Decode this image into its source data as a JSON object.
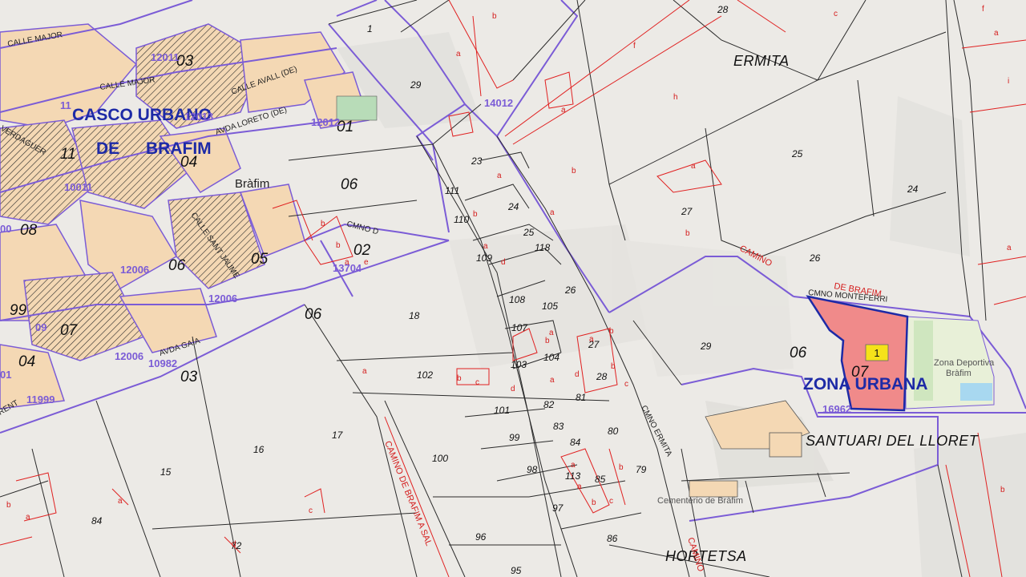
{
  "labels": {
    "casco": "CASCO URBANO",
    "de": "DE",
    "brafim_town": "BRAFIM",
    "ermita": "ERMITA",
    "zona_urbana": "ZONA URBANA",
    "santuari": "SANTUARI DEL LLORET",
    "hortetsa": "HORTETSA",
    "brafim_point": "Bràfim",
    "cementerio": "Cementerio de Bràfim",
    "zona_deportiva_1": "Zona Deportiva",
    "zona_deportiva_2": "Bràfim",
    "selected_parcel_badge": "1"
  },
  "streets": {
    "calle_major": "CALLE MAJOR",
    "carrer_avall": "CALLE AVALL (DE)",
    "avda_loreto": "AVDA LORETO (DE)",
    "calle_major2": "CALLE MAJOR",
    "verdaguer": "VERDAGUER",
    "sant_jaume": "CALLE SANT JAUME",
    "avda_gaia": "AVDA GAIA",
    "cmno_d": "CMNO D",
    "cami_ermita": "CMNO ERMITA",
    "cami_monteferri": "CMNO MONTEFERRI",
    "camino_brafim": "CAMINO",
    "de_brafim": "DE BRAFIM",
    "camino_sal": "CAMINO DE BRAFIM A SAL",
    "camino_vertical": "CAMINO",
    "rent": "RENT"
  },
  "zones": [
    "03",
    "01",
    "04",
    "11",
    "08",
    "06",
    "05",
    "99",
    "07",
    "04",
    "03",
    "06",
    "02",
    "06",
    "07"
  ],
  "purple_codes": [
    "12011",
    "12013",
    "12012",
    "10011",
    "12006",
    "12006",
    "12006",
    "10982",
    "11999",
    "14012",
    "13704",
    "16962",
    "11",
    "00",
    "09",
    "01"
  ],
  "parcels": [
    "1",
    "29",
    "28",
    "23",
    "111",
    "110",
    "109",
    "24",
    "25",
    "118",
    "25",
    "24",
    "27",
    "26",
    "108",
    "105",
    "107",
    "104",
    "103",
    "102",
    "101",
    "82",
    "83",
    "84",
    "81",
    "99",
    "98",
    "97",
    "96",
    "95",
    "100",
    "26",
    "29",
    "28",
    "27",
    "113",
    "85",
    "86",
    "80",
    "79",
    "17",
    "16",
    "15",
    "18",
    "84",
    "72"
  ],
  "subparcels": [
    "a",
    "b",
    "a",
    "b",
    "f",
    "h",
    "a",
    "b",
    "i",
    "a",
    "a",
    "b",
    "a",
    "c",
    "d",
    "e",
    "a",
    "b",
    "a",
    "b",
    "c",
    "d",
    "a",
    "b",
    "a",
    "b",
    "c",
    "a",
    "b",
    "a",
    "b",
    "c",
    "d",
    "a",
    "b",
    "c",
    "a",
    "d",
    "a",
    "b",
    "f",
    "c",
    "a",
    "b",
    "a",
    "b"
  ]
}
